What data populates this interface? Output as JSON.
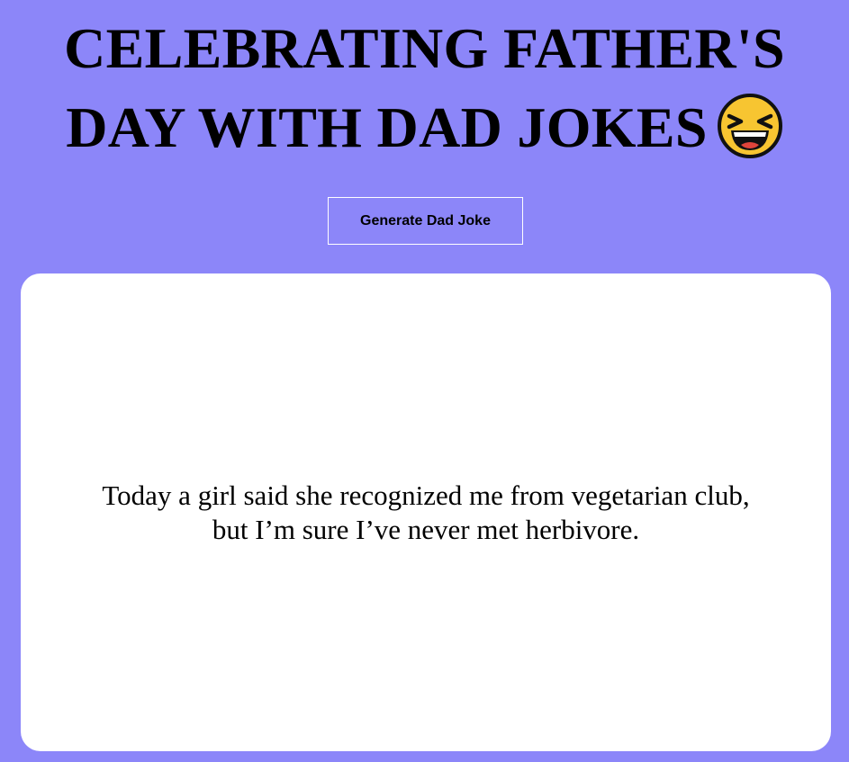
{
  "header": {
    "title_line1": "CELEBRATING FATHER'S",
    "title_line2": "DAY WITH DAD JOKES",
    "title_emoji_icon": "laughing-squinting-face-icon"
  },
  "controls": {
    "generate_button_label": "Generate Dad Joke"
  },
  "joke": {
    "line1": "Today a girl said she recognized me from vegetarian club,",
    "line2": "but I’m sure I’ve never met herbivore."
  },
  "colors": {
    "background": "#8c86f9",
    "card": "#ffffff",
    "button_border": "#ffffff",
    "text": "#000000",
    "emoji_face": "#f7c531"
  }
}
